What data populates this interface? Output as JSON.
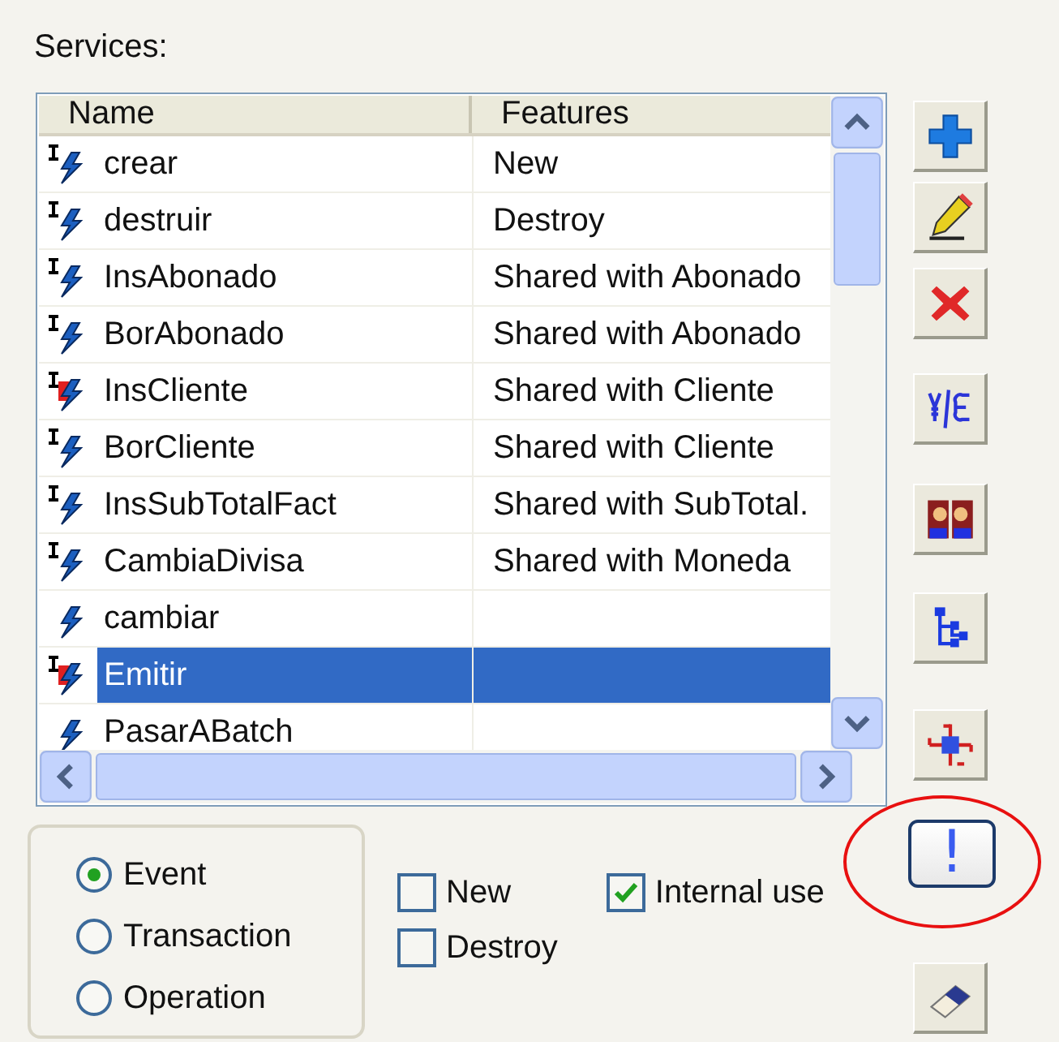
{
  "label": "Services:",
  "table": {
    "columns": [
      "Name",
      "Features"
    ],
    "rows": [
      {
        "name": "crear",
        "features": "New",
        "interface": true,
        "badge": false,
        "selected": false
      },
      {
        "name": "destruir",
        "features": "Destroy",
        "interface": true,
        "badge": false,
        "selected": false
      },
      {
        "name": "InsAbonado",
        "features": "Shared with Abonado",
        "interface": true,
        "badge": false,
        "selected": false
      },
      {
        "name": "BorAbonado",
        "features": "Shared with Abonado",
        "interface": true,
        "badge": false,
        "selected": false
      },
      {
        "name": "InsCliente",
        "features": "Shared with Cliente",
        "interface": true,
        "badge": true,
        "selected": false
      },
      {
        "name": "BorCliente",
        "features": "Shared with Cliente",
        "interface": true,
        "badge": false,
        "selected": false
      },
      {
        "name": "InsSubTotalFact",
        "features": "Shared with SubTotal.",
        "interface": true,
        "badge": false,
        "selected": false
      },
      {
        "name": "CambiaDivisa",
        "features": "Shared with Moneda",
        "interface": true,
        "badge": false,
        "selected": false
      },
      {
        "name": "cambiar",
        "features": "",
        "interface": false,
        "badge": false,
        "selected": false
      },
      {
        "name": "Emitir",
        "features": "",
        "interface": true,
        "badge": true,
        "selected": true
      },
      {
        "name": "PasarABatch",
        "features": "",
        "interface": false,
        "badge": false,
        "selected": false
      }
    ]
  },
  "toolbar": [
    {
      "kind": "add"
    },
    {
      "kind": "edit"
    },
    {
      "kind": "delete"
    },
    {
      "kind": "currency"
    },
    {
      "kind": "mirror"
    },
    {
      "kind": "tree"
    },
    {
      "kind": "network"
    },
    {
      "kind": "alert",
      "label": "!",
      "highlighted": true
    },
    {
      "kind": "eraser"
    }
  ],
  "type_options": [
    {
      "label": "Event",
      "selected": true
    },
    {
      "label": "Transaction",
      "selected": false
    },
    {
      "label": "Operation",
      "selected": false
    }
  ],
  "checkboxes": [
    {
      "label": "New",
      "checked": false
    },
    {
      "label": "Destroy",
      "checked": false
    },
    {
      "label": "Internal use",
      "checked": true
    }
  ]
}
